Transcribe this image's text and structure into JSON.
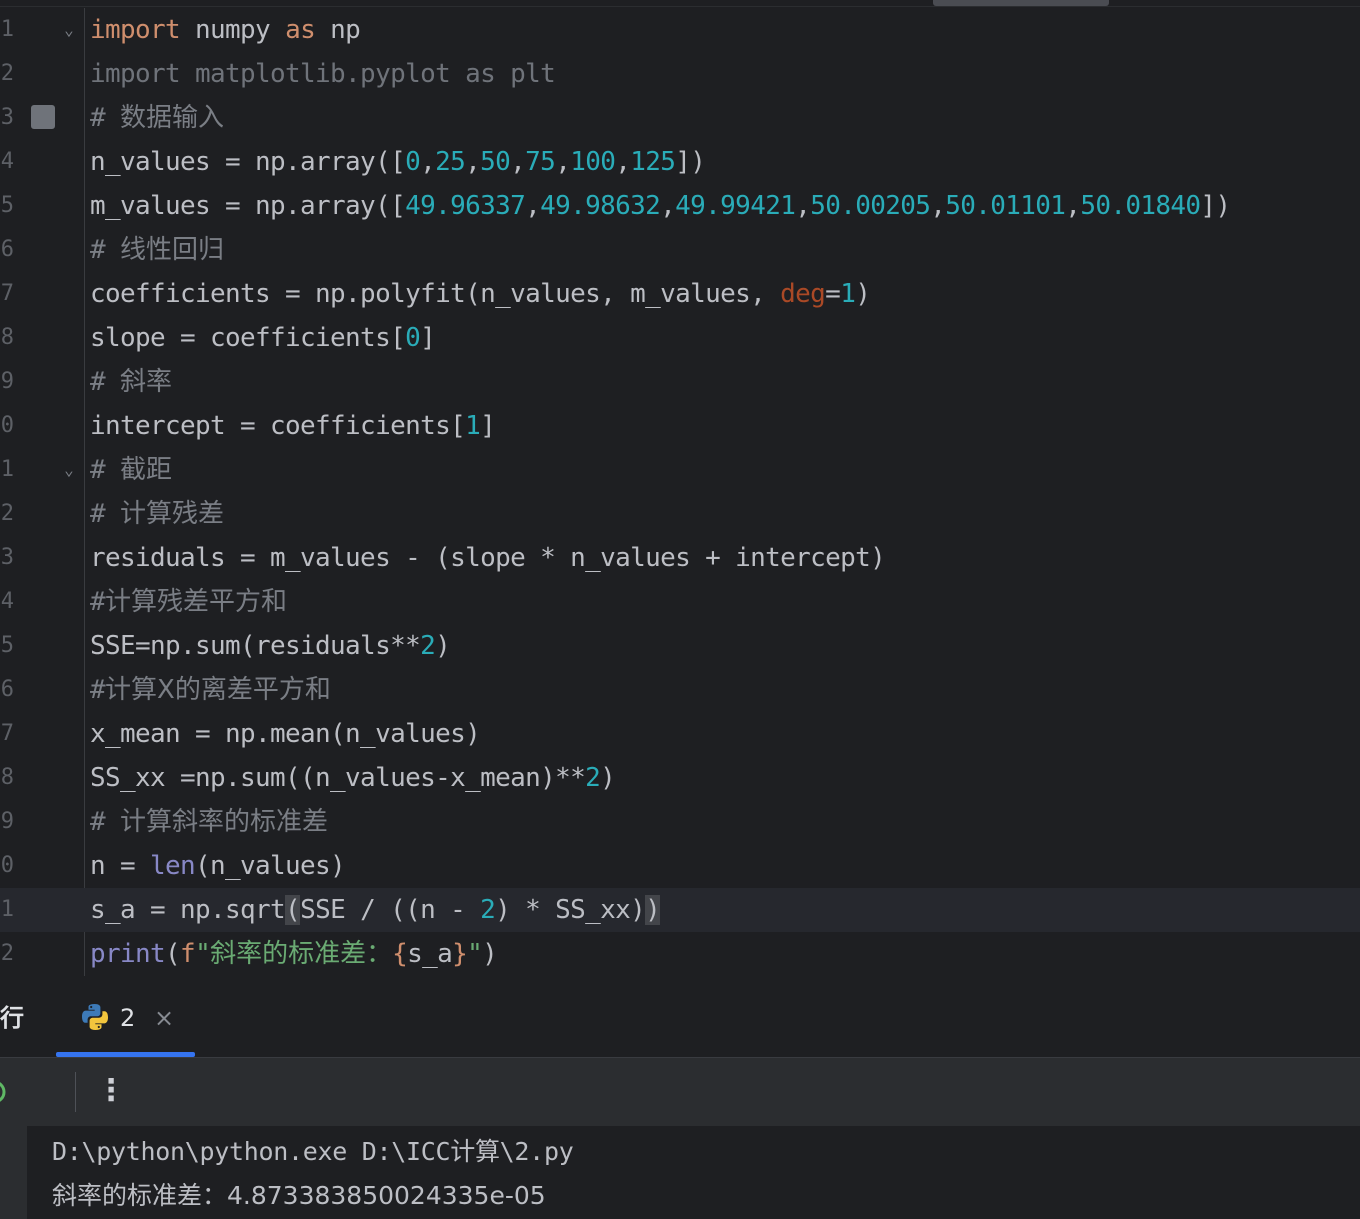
{
  "editor": {
    "line_numbers": [
      "1",
      "2",
      "3",
      "4",
      "5",
      "6",
      "7",
      "8",
      "9",
      "0",
      "1",
      "2",
      "3",
      "4",
      "5",
      "6",
      "7",
      "8",
      "9",
      "0",
      "1",
      "2"
    ],
    "lines": [
      {
        "segments": [
          {
            "t": "import",
            "c": "kw"
          },
          {
            "t": " numpy "
          },
          {
            "t": "as",
            "c": "kw"
          },
          {
            "t": " np"
          }
        ],
        "fold": true
      },
      {
        "segments": [
          {
            "t": "import matplotlib.pyplot as plt",
            "c": "dim"
          }
        ]
      },
      {
        "segments": [
          {
            "t": "# ",
            "c": "cm"
          },
          {
            "t": "数据输入",
            "c": "cm cjk"
          }
        ]
      },
      {
        "segments": [
          {
            "t": "n_values = np.array(["
          },
          {
            "t": "0",
            "c": "num"
          },
          {
            "t": ","
          },
          {
            "t": "25",
            "c": "num"
          },
          {
            "t": ","
          },
          {
            "t": "50",
            "c": "num"
          },
          {
            "t": ","
          },
          {
            "t": "75",
            "c": "num"
          },
          {
            "t": ","
          },
          {
            "t": "100",
            "c": "num"
          },
          {
            "t": ","
          },
          {
            "t": "125",
            "c": "num"
          },
          {
            "t": "])"
          }
        ]
      },
      {
        "segments": [
          {
            "t": "m_values = np.array(["
          },
          {
            "t": "49.96337",
            "c": "num"
          },
          {
            "t": ","
          },
          {
            "t": "49.98632",
            "c": "num"
          },
          {
            "t": ","
          },
          {
            "t": "49.99421",
            "c": "num"
          },
          {
            "t": ","
          },
          {
            "t": "50.00205",
            "c": "num"
          },
          {
            "t": ","
          },
          {
            "t": "50.01101",
            "c": "num"
          },
          {
            "t": ","
          },
          {
            "t": "50.01840",
            "c": "num"
          },
          {
            "t": "])"
          }
        ]
      },
      {
        "segments": [
          {
            "t": "# ",
            "c": "cm"
          },
          {
            "t": "线性回归",
            "c": "cm cjk"
          }
        ]
      },
      {
        "segments": [
          {
            "t": "coefficients = np.polyfit(n_values, m_values, "
          },
          {
            "t": "deg",
            "c": "par"
          },
          {
            "t": "="
          },
          {
            "t": "1",
            "c": "num"
          },
          {
            "t": ")"
          }
        ]
      },
      {
        "segments": [
          {
            "t": "slope = coefficients["
          },
          {
            "t": "0",
            "c": "num"
          },
          {
            "t": "]"
          }
        ]
      },
      {
        "segments": [
          {
            "t": "# ",
            "c": "cm"
          },
          {
            "t": "斜率",
            "c": "cm cjk"
          }
        ]
      },
      {
        "segments": [
          {
            "t": "intercept = coefficients["
          },
          {
            "t": "1",
            "c": "num"
          },
          {
            "t": "]"
          }
        ]
      },
      {
        "segments": [
          {
            "t": "# ",
            "c": "cm"
          },
          {
            "t": "截距",
            "c": "cm cjk"
          }
        ],
        "fold": true
      },
      {
        "segments": [
          {
            "t": "# ",
            "c": "cm"
          },
          {
            "t": "计算残差",
            "c": "cm cjk"
          }
        ]
      },
      {
        "segments": [
          {
            "t": "residuals = m_values - (slope * n_values + intercept)"
          }
        ]
      },
      {
        "segments": [
          {
            "t": "#",
            "c": "cm"
          },
          {
            "t": "计算残差平方和",
            "c": "cm cjk"
          }
        ]
      },
      {
        "segments": [
          {
            "t": "SSE=np.sum(residuals**"
          },
          {
            "t": "2",
            "c": "num"
          },
          {
            "t": ")"
          }
        ]
      },
      {
        "segments": [
          {
            "t": "#",
            "c": "cm"
          },
          {
            "t": "计算X的离差平方和",
            "c": "cm cjk"
          }
        ]
      },
      {
        "segments": [
          {
            "t": "x_mean = np.mean(n_values)"
          }
        ]
      },
      {
        "segments": [
          {
            "t": "SS_xx =np.sum((n_values-x_mean)**"
          },
          {
            "t": "2",
            "c": "num"
          },
          {
            "t": ")"
          }
        ]
      },
      {
        "segments": [
          {
            "t": "# ",
            "c": "cm"
          },
          {
            "t": "计算斜率的标准差",
            "c": "cm cjk"
          }
        ]
      },
      {
        "segments": [
          {
            "t": "n = "
          },
          {
            "t": "len",
            "c": "bi"
          },
          {
            "t": "(n_values)"
          }
        ]
      },
      {
        "segments": [
          {
            "t": "s_a = np.sqrt"
          },
          {
            "t": "(",
            "c": "bracket-hl"
          },
          {
            "t": "SSE / ((n - "
          },
          {
            "t": "2",
            "c": "num"
          },
          {
            "t": ") * SS_xx)"
          },
          {
            "t": ")",
            "c": "bracket-hl"
          }
        ],
        "current": true
      },
      {
        "segments": [
          {
            "t": "print",
            "c": "bi"
          },
          {
            "t": "("
          },
          {
            "t": "f",
            "c": "fs"
          },
          {
            "t": "\"",
            "c": "str"
          },
          {
            "t": "斜率的标准差：",
            "c": "str cjk"
          },
          {
            "t": "{",
            "c": "fs"
          },
          {
            "t": "s_a"
          },
          {
            "t": "}",
            "c": "fs"
          },
          {
            "t": "\"",
            "c": "str"
          },
          {
            "t": ")"
          }
        ]
      }
    ]
  },
  "tool_window": {
    "run_label": "行",
    "tab": {
      "label": "2",
      "close": "×",
      "icon": "python-icon"
    },
    "toolbar": {
      "rerun_icon": "rerun-icon",
      "stop_icon": "stop-icon",
      "more": "⋮"
    }
  },
  "console": {
    "lines": [
      "D:\\python\\python.exe D:\\ICC计算\\2.py",
      "斜率的标准差：4.873383850024335e-05"
    ]
  },
  "colors": {
    "keyword": "#cf8e6d",
    "number": "#2aacb8",
    "comment": "#7a7e85",
    "builtin": "#8888c6",
    "string": "#6aab73",
    "param": "#aa4926",
    "text": "#bcbec4",
    "accent": "#3574f0"
  }
}
